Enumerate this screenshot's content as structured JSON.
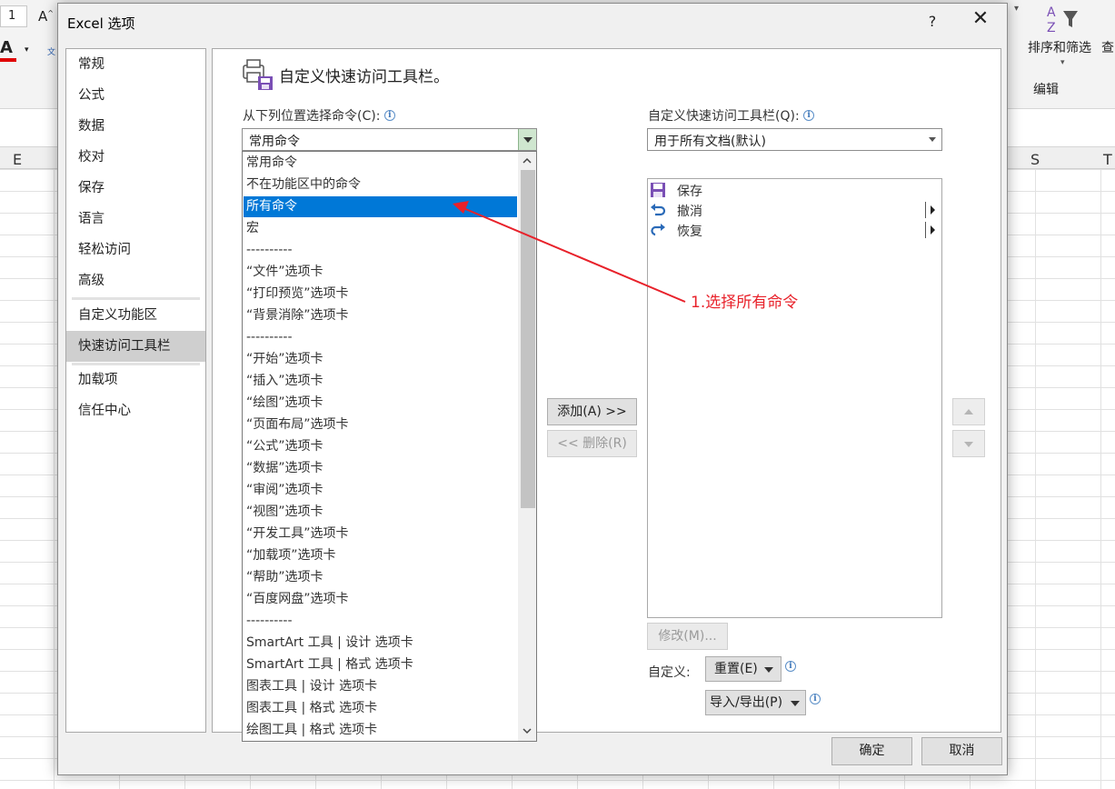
{
  "background": {
    "col_letters": [
      "E",
      "S",
      "T"
    ],
    "sort_filter_label": "排序和筛选",
    "find_label_partial": "查",
    "edit_group_label": "编辑",
    "font_size_partial": "1"
  },
  "dialog": {
    "title": "Excel 选项",
    "help": "?",
    "close": "✕"
  },
  "nav": {
    "items": [
      "常规",
      "公式",
      "数据",
      "校对",
      "保存",
      "语言",
      "轻松访问",
      "高级",
      "自定义功能区",
      "快速访问工具栏",
      "加载项",
      "信任中心"
    ],
    "selected": "快速访问工具栏"
  },
  "content": {
    "header": "自定义快速访问工具栏。",
    "choose_label": "从下列位置选择命令(C):",
    "choose_value": "常用命令",
    "customize_label": "自定义快速访问工具栏(Q):",
    "customize_value": "用于所有文档(默认)",
    "dropdown_options": [
      "常用命令",
      "不在功能区中的命令",
      "所有命令",
      "宏",
      "----------",
      "“文件”选项卡",
      "“打印预览”选项卡",
      "“背景消除”选项卡",
      "----------",
      "“开始”选项卡",
      "“插入”选项卡",
      "“绘图”选项卡",
      "“页面布局”选项卡",
      "“公式”选项卡",
      "“数据”选项卡",
      "“审阅”选项卡",
      "“视图”选项卡",
      "“开发工具”选项卡",
      "“加载项”选项卡",
      "“帮助”选项卡",
      "“百度网盘”选项卡",
      "----------",
      "SmartArt 工具 | 设计 选项卡",
      "SmartArt 工具 | 格式 选项卡",
      "图表工具 | 设计 选项卡",
      "图表工具 | 格式 选项卡",
      "绘图工具 | 格式 选项卡"
    ],
    "dropdown_selected": "所有命令",
    "add_button": "添加(A) >>",
    "remove_button": "<< 删除(R)",
    "toolbar_items": [
      {
        "label": "保存",
        "icon": "save-icon"
      },
      {
        "label": "撤消",
        "icon": "undo-icon"
      },
      {
        "label": "恢复",
        "icon": "redo-icon"
      }
    ],
    "modify_button": "修改(M)...",
    "customize_row_label": "自定义:",
    "reset_button": "重置(E)",
    "import_export_button": "导入/导出(P)",
    "ok_button": "确定",
    "cancel_button": "取消"
  },
  "annotation": {
    "text": "1.选择所有命令",
    "color": "#e8212a"
  },
  "colors": {
    "selection": "#0078d7",
    "dialog_bg": "#f0f0f0"
  }
}
